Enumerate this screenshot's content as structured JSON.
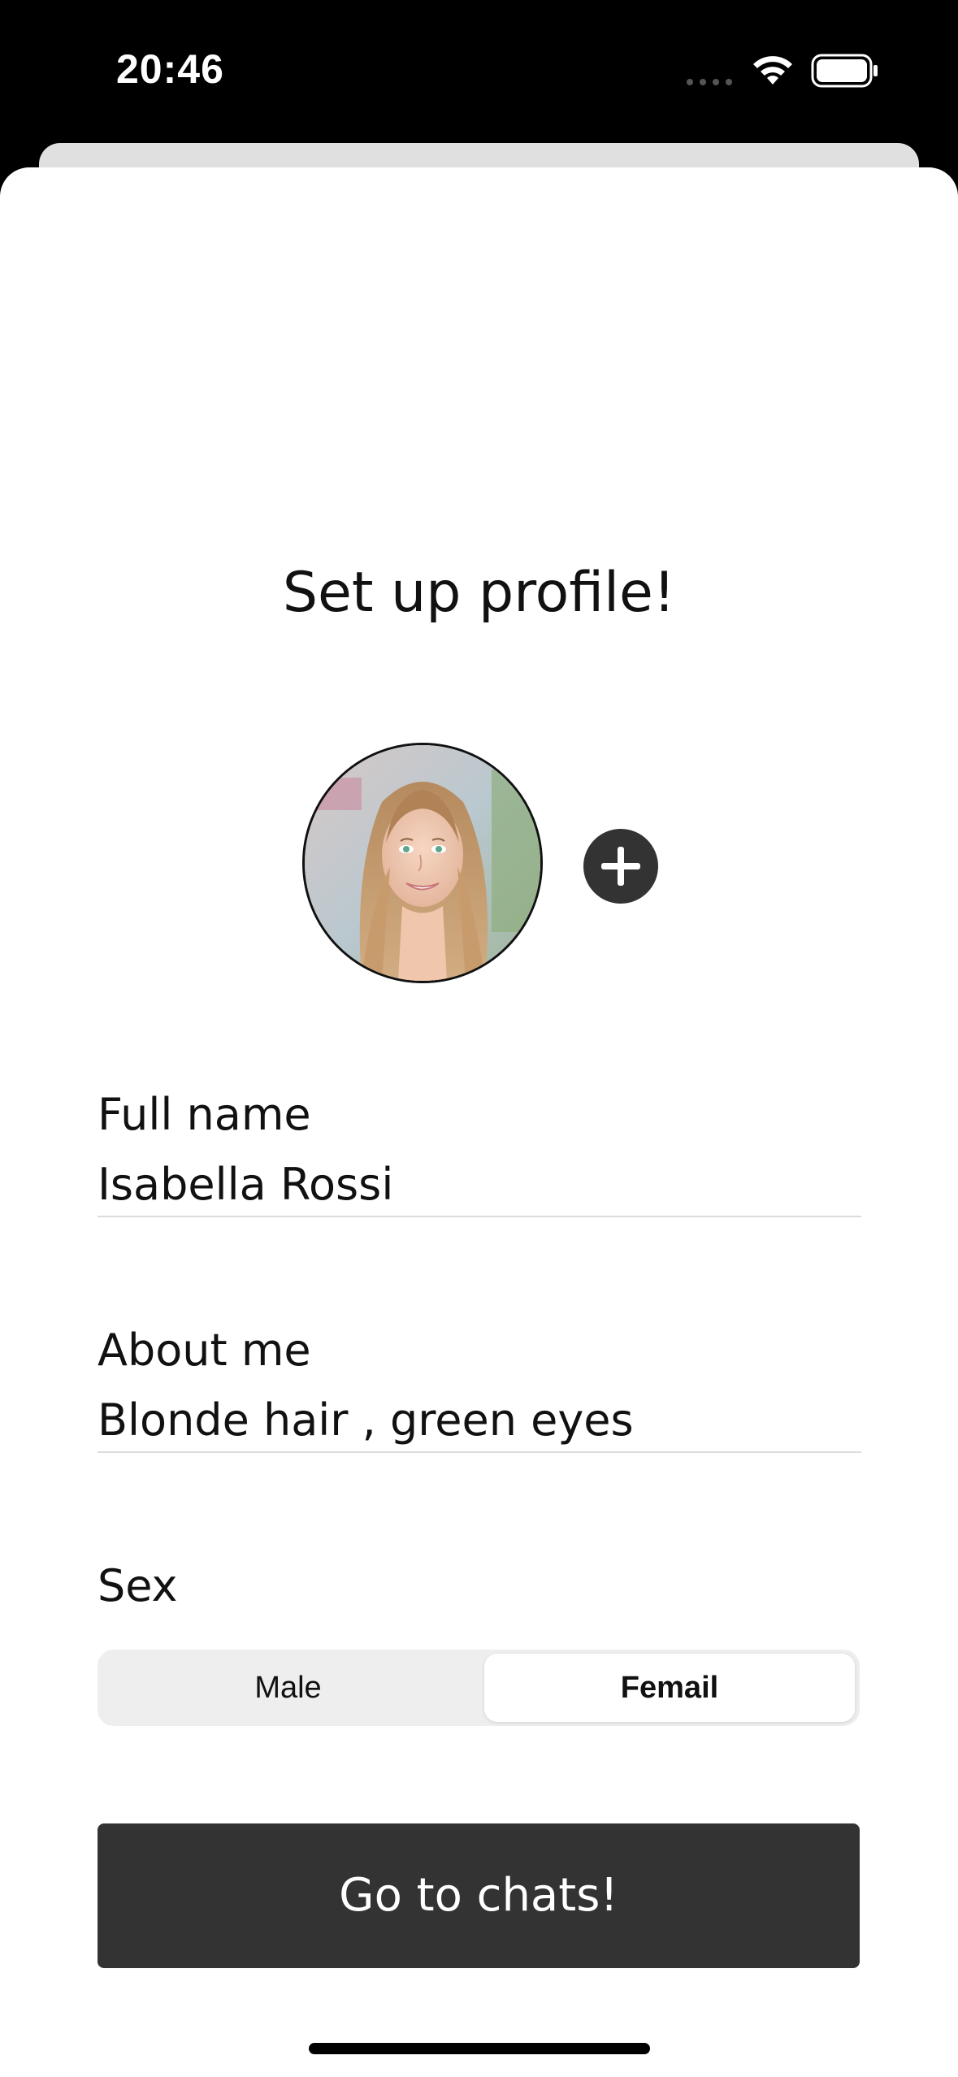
{
  "status_bar": {
    "time": "20:46",
    "icons": [
      "signal-dots-icon",
      "wifi-icon",
      "battery-icon"
    ]
  },
  "profile": {
    "title": "Set up profile!",
    "avatar_icon": "avatar-photo",
    "add_photo_icon": "plus-icon"
  },
  "form": {
    "full_name": {
      "label": "Full name",
      "value": "Isabella Rossi"
    },
    "about_me": {
      "label": "About me",
      "value": "Blonde hair , green eyes"
    },
    "sex": {
      "label": "Sex",
      "options": [
        "Male",
        "Femail"
      ],
      "selected": "Femail"
    }
  },
  "actions": {
    "go_to_chats": "Go to chats!"
  },
  "colors": {
    "background": "#000000",
    "sheet": "#ffffff",
    "button": "#333333",
    "segment_track": "#eeeeee",
    "text": "#111111"
  }
}
